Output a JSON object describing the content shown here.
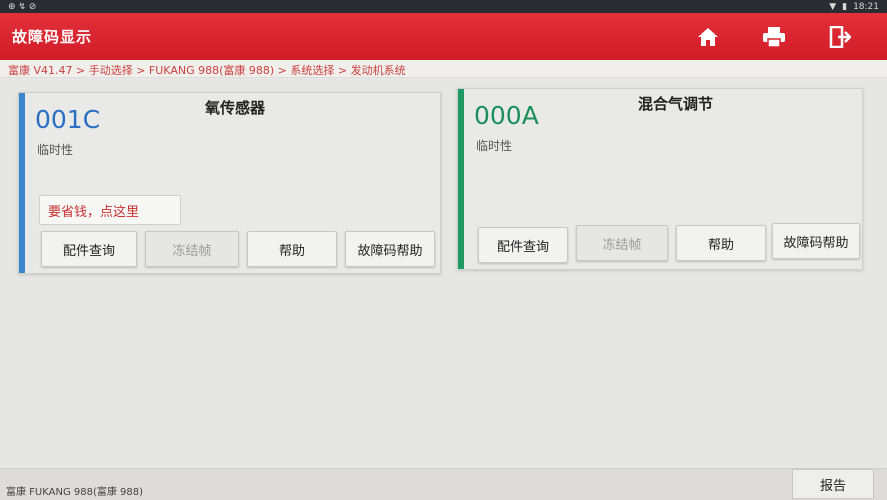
{
  "statusbar": {
    "left": "⊕ ↯ ⊘",
    "time": "18:21"
  },
  "header": {
    "title": "故障码显示",
    "home_icon": "home-icon",
    "print_icon": "printer-icon",
    "exit_icon": "exit-icon"
  },
  "breadcrumb": "富康 V41.47 > 手动选择 > FUKANG 988(富康 988) > 系统选择 > 发动机系统",
  "colors": {
    "accent": "#d8232e",
    "blue_stripe": "#3c86d0",
    "green_stripe": "#1f9a64",
    "code_blue": "#2a6fc2",
    "code_green": "#1d8f5a"
  },
  "cards": [
    {
      "code": "001C",
      "name": "氧传感器",
      "status": "临时性",
      "tooltip": "要省钱，点这里",
      "buttons": {
        "parts": "配件查询",
        "freeze": "冻结帧",
        "help": "帮助",
        "dtc_help": "故障码帮助"
      }
    },
    {
      "code": "000A",
      "name": "混合气调节",
      "status": "临时性",
      "buttons": {
        "parts": "配件查询",
        "freeze": "冻结帧",
        "help": "帮助",
        "dtc_help": "故障码帮助"
      }
    }
  ],
  "footer": {
    "vehicle": "富康 FUKANG 988(富康 988)",
    "report": "报告"
  }
}
